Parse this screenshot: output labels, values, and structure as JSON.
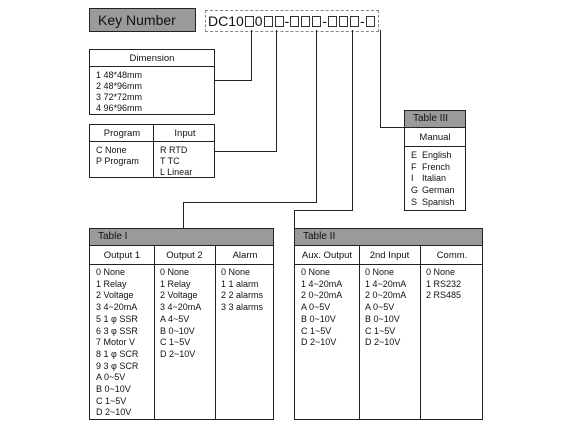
{
  "key": {
    "label": "Key Number",
    "model_prefix": "DC10",
    "fixed_digit": "0",
    "separator": "-"
  },
  "dimension": {
    "title": "Dimension",
    "items": [
      "1 48*48mm",
      "2 48*96mm",
      "3 72*72mm",
      "4 96*96mm"
    ]
  },
  "program_input": {
    "program_title": "Program",
    "input_title": "Input",
    "program_items": [
      "C None",
      "P Program"
    ],
    "input_items": [
      "R RTD",
      "T TC",
      "L Linear"
    ]
  },
  "table3": {
    "header": "Table III",
    "title": "Manual",
    "items": [
      {
        "code": "E",
        "name": "English"
      },
      {
        "code": "F",
        "name": "French"
      },
      {
        "code": "I",
        "name": "Italian"
      },
      {
        "code": "G",
        "name": "German"
      },
      {
        "code": "S",
        "name": "Spanish"
      }
    ]
  },
  "table1": {
    "header": "Table I",
    "columns": [
      {
        "title": "Output 1",
        "items": [
          "0 None",
          "1 Relay",
          "2 Voltage",
          "3 4~20mA",
          "5 1 φ SSR",
          "6 3 φ SSR",
          "7 Motor V",
          "8 1 φ SCR",
          "9 3 φ SCR",
          "A 0~5V",
          "B 0~10V",
          "C 1~5V",
          "D 2~10V"
        ]
      },
      {
        "title": "Output 2",
        "items": [
          "0 None",
          "1 Relay",
          "2 Voltage",
          "3 4~20mA",
          "A 4~5V",
          "B 0~10V",
          "C 1~5V",
          "D 2~10V"
        ]
      },
      {
        "title": "Alarm",
        "items": [
          "0 None",
          "1 1 alarm",
          "2 2 alarms",
          "3 3 alarms"
        ]
      }
    ]
  },
  "table2": {
    "header": "Table II",
    "columns": [
      {
        "title": "Aux. Output",
        "items": [
          "0 None",
          "1 4~20mA",
          "2 0~20mA",
          "A 0~5V",
          "B 0~10V",
          "C 1~5V",
          "D 2~10V"
        ]
      },
      {
        "title": "2nd Input",
        "items": [
          "0 None",
          "1 4~20mA",
          "2 0~20mA",
          "A 0~5V",
          "B 0~10V",
          "C 1~5V",
          "D 2~10V"
        ]
      },
      {
        "title": "Comm.",
        "items": [
          "0 None",
          "1 RS232",
          "2 RS485"
        ]
      }
    ]
  }
}
